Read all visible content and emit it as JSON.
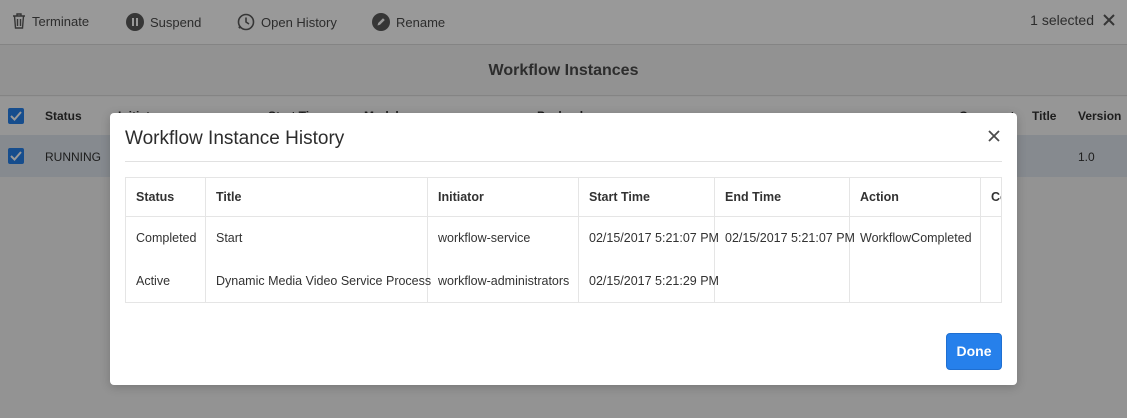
{
  "toolbar": {
    "terminate_label": "Terminate",
    "suspend_label": "Suspend",
    "open_history_label": "Open History",
    "rename_label": "Rename",
    "selected_label": "1 selected"
  },
  "page": {
    "title": "Workflow Instances"
  },
  "list": {
    "columns": [
      "Status",
      "Initiator",
      "Start Time",
      "Model",
      "Payload",
      "Comment",
      "Title",
      "Version"
    ],
    "row": {
      "status": "RUNNING",
      "version": "1.0"
    }
  },
  "dialog": {
    "title": "Workflow Instance History",
    "columns": [
      "Status",
      "Title",
      "Initiator",
      "Start Time",
      "End Time",
      "Action",
      "Co"
    ],
    "rows": [
      {
        "status": "Completed",
        "title": "Start",
        "initiator": "workflow-service",
        "start_time": "02/15/2017 5:21:07 PM",
        "end_time": "02/15/2017 5:21:07 PM",
        "action": "WorkflowCompleted"
      },
      {
        "status": "Active",
        "title": "Dynamic Media Video Service Process",
        "initiator": "workflow-administrators",
        "start_time": "02/15/2017 5:21:29 PM",
        "end_time": "",
        "action": ""
      }
    ],
    "done_label": "Done"
  },
  "colors": {
    "accent": "#2680eb",
    "overlay": "rgba(0,0,0,0.40)",
    "selected_row": "#dfe6ee"
  }
}
